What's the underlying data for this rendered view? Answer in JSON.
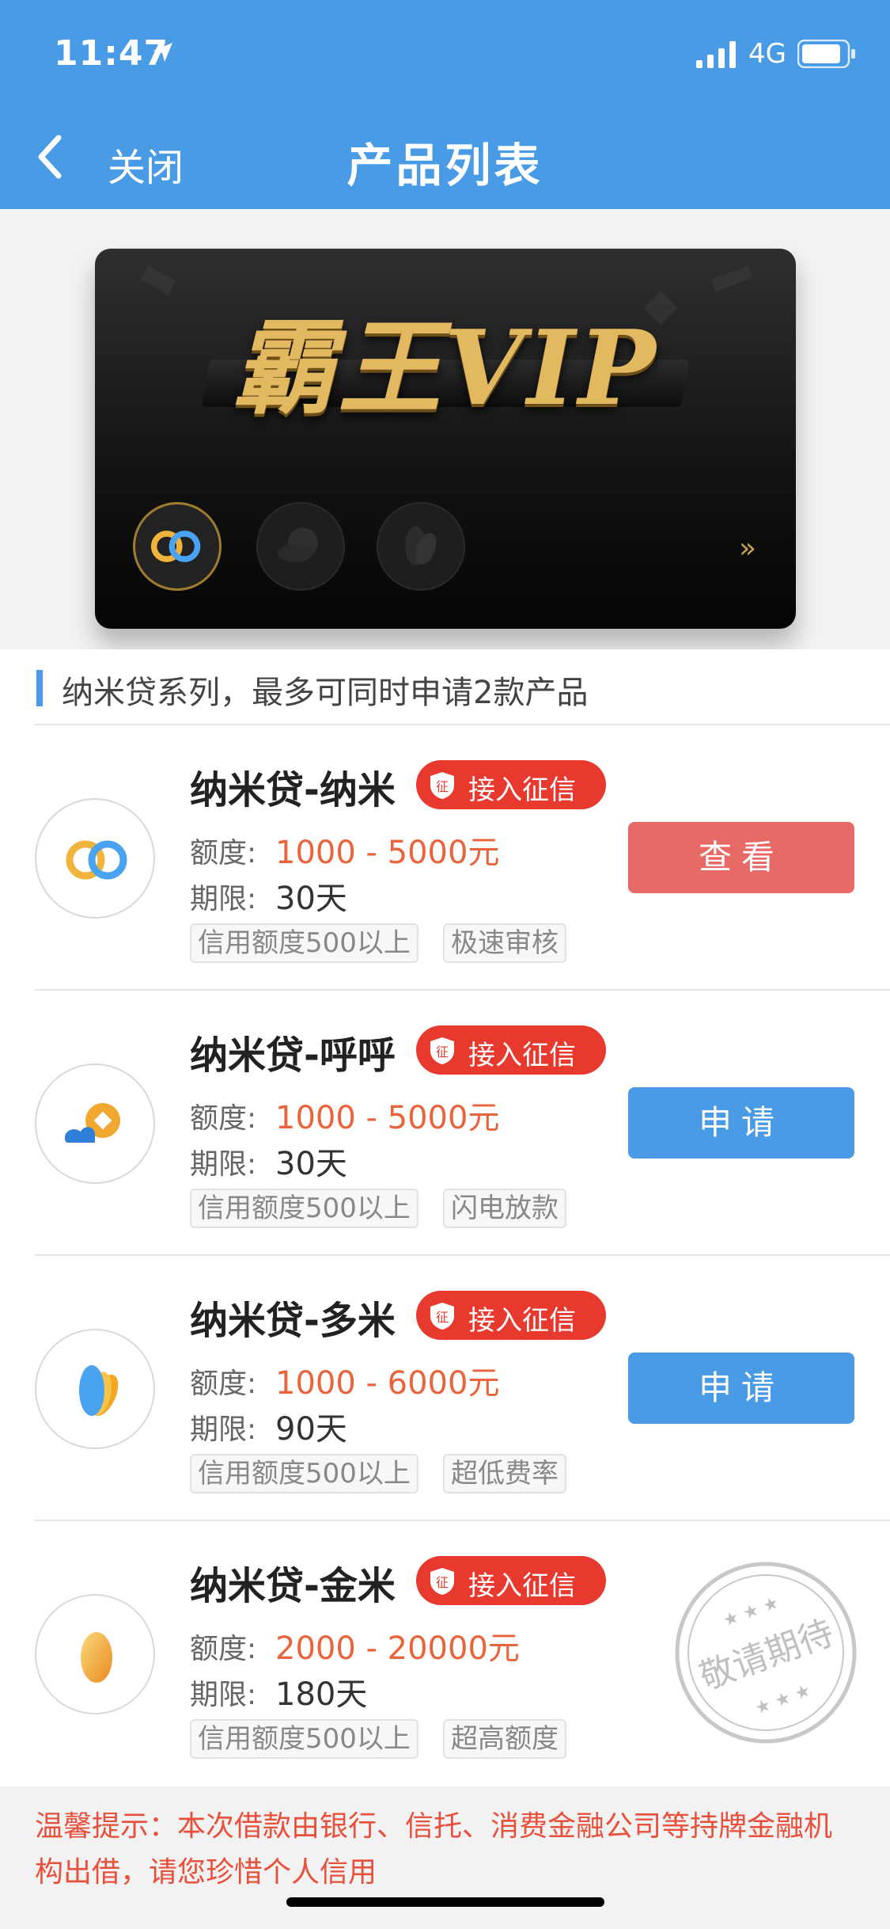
{
  "status": {
    "time": "11:47",
    "network": "4G"
  },
  "nav": {
    "back_label": "关闭",
    "title": "产品列表"
  },
  "banner": {
    "title": "霸王VIP",
    "more": "»"
  },
  "section": {
    "text": "纳米贷系列，最多可同时申请2款产品"
  },
  "products": [
    {
      "name": "纳米贷-纳米",
      "badge": "接入征信",
      "badge_icon_text": "征",
      "amount_label": "额度:",
      "amount": "1000 - 5000元",
      "term_label": "期限:",
      "term": "30天",
      "tags": [
        "信用额度500以上",
        "极速审核"
      ],
      "button": "查看",
      "icon": "infinity-rings-icon"
    },
    {
      "name": "纳米贷-呼呼",
      "badge": "接入征信",
      "badge_icon_text": "征",
      "amount_label": "额度:",
      "amount": "1000 - 5000元",
      "term_label": "期限:",
      "term": "30天",
      "tags": [
        "信用额度500以上",
        "闪电放款"
      ],
      "button": "申请",
      "icon": "coin-cloud-icon"
    },
    {
      "name": "纳米贷-多米",
      "badge": "接入征信",
      "badge_icon_text": "征",
      "amount_label": "额度:",
      "amount": "1000 - 6000元",
      "term_label": "期限:",
      "term": "90天",
      "tags": [
        "信用额度500以上",
        "超低费率"
      ],
      "button": "申请",
      "icon": "rice-petals-icon"
    },
    {
      "name": "纳米贷-金米",
      "badge": "接入征信",
      "badge_icon_text": "征",
      "amount_label": "额度:",
      "amount": "2000 - 20000元",
      "term_label": "期限:",
      "term": "180天",
      "tags": [
        "信用额度500以上",
        "超高额度"
      ],
      "stamp": "敬请期待",
      "icon": "golden-rice-icon"
    }
  ],
  "tip": {
    "text": "温馨提示：本次借款由银行、信托、消费金融公司等持牌金融机构出借，请您珍惜个人信用"
  },
  "colors": {
    "primary_blue": "#4a9be6",
    "view_button": "#e86a66",
    "badge_red": "#e8392e",
    "amount_orange": "#e8643c",
    "tip_red": "#e8503c",
    "vip_gold": "#e2b860"
  }
}
